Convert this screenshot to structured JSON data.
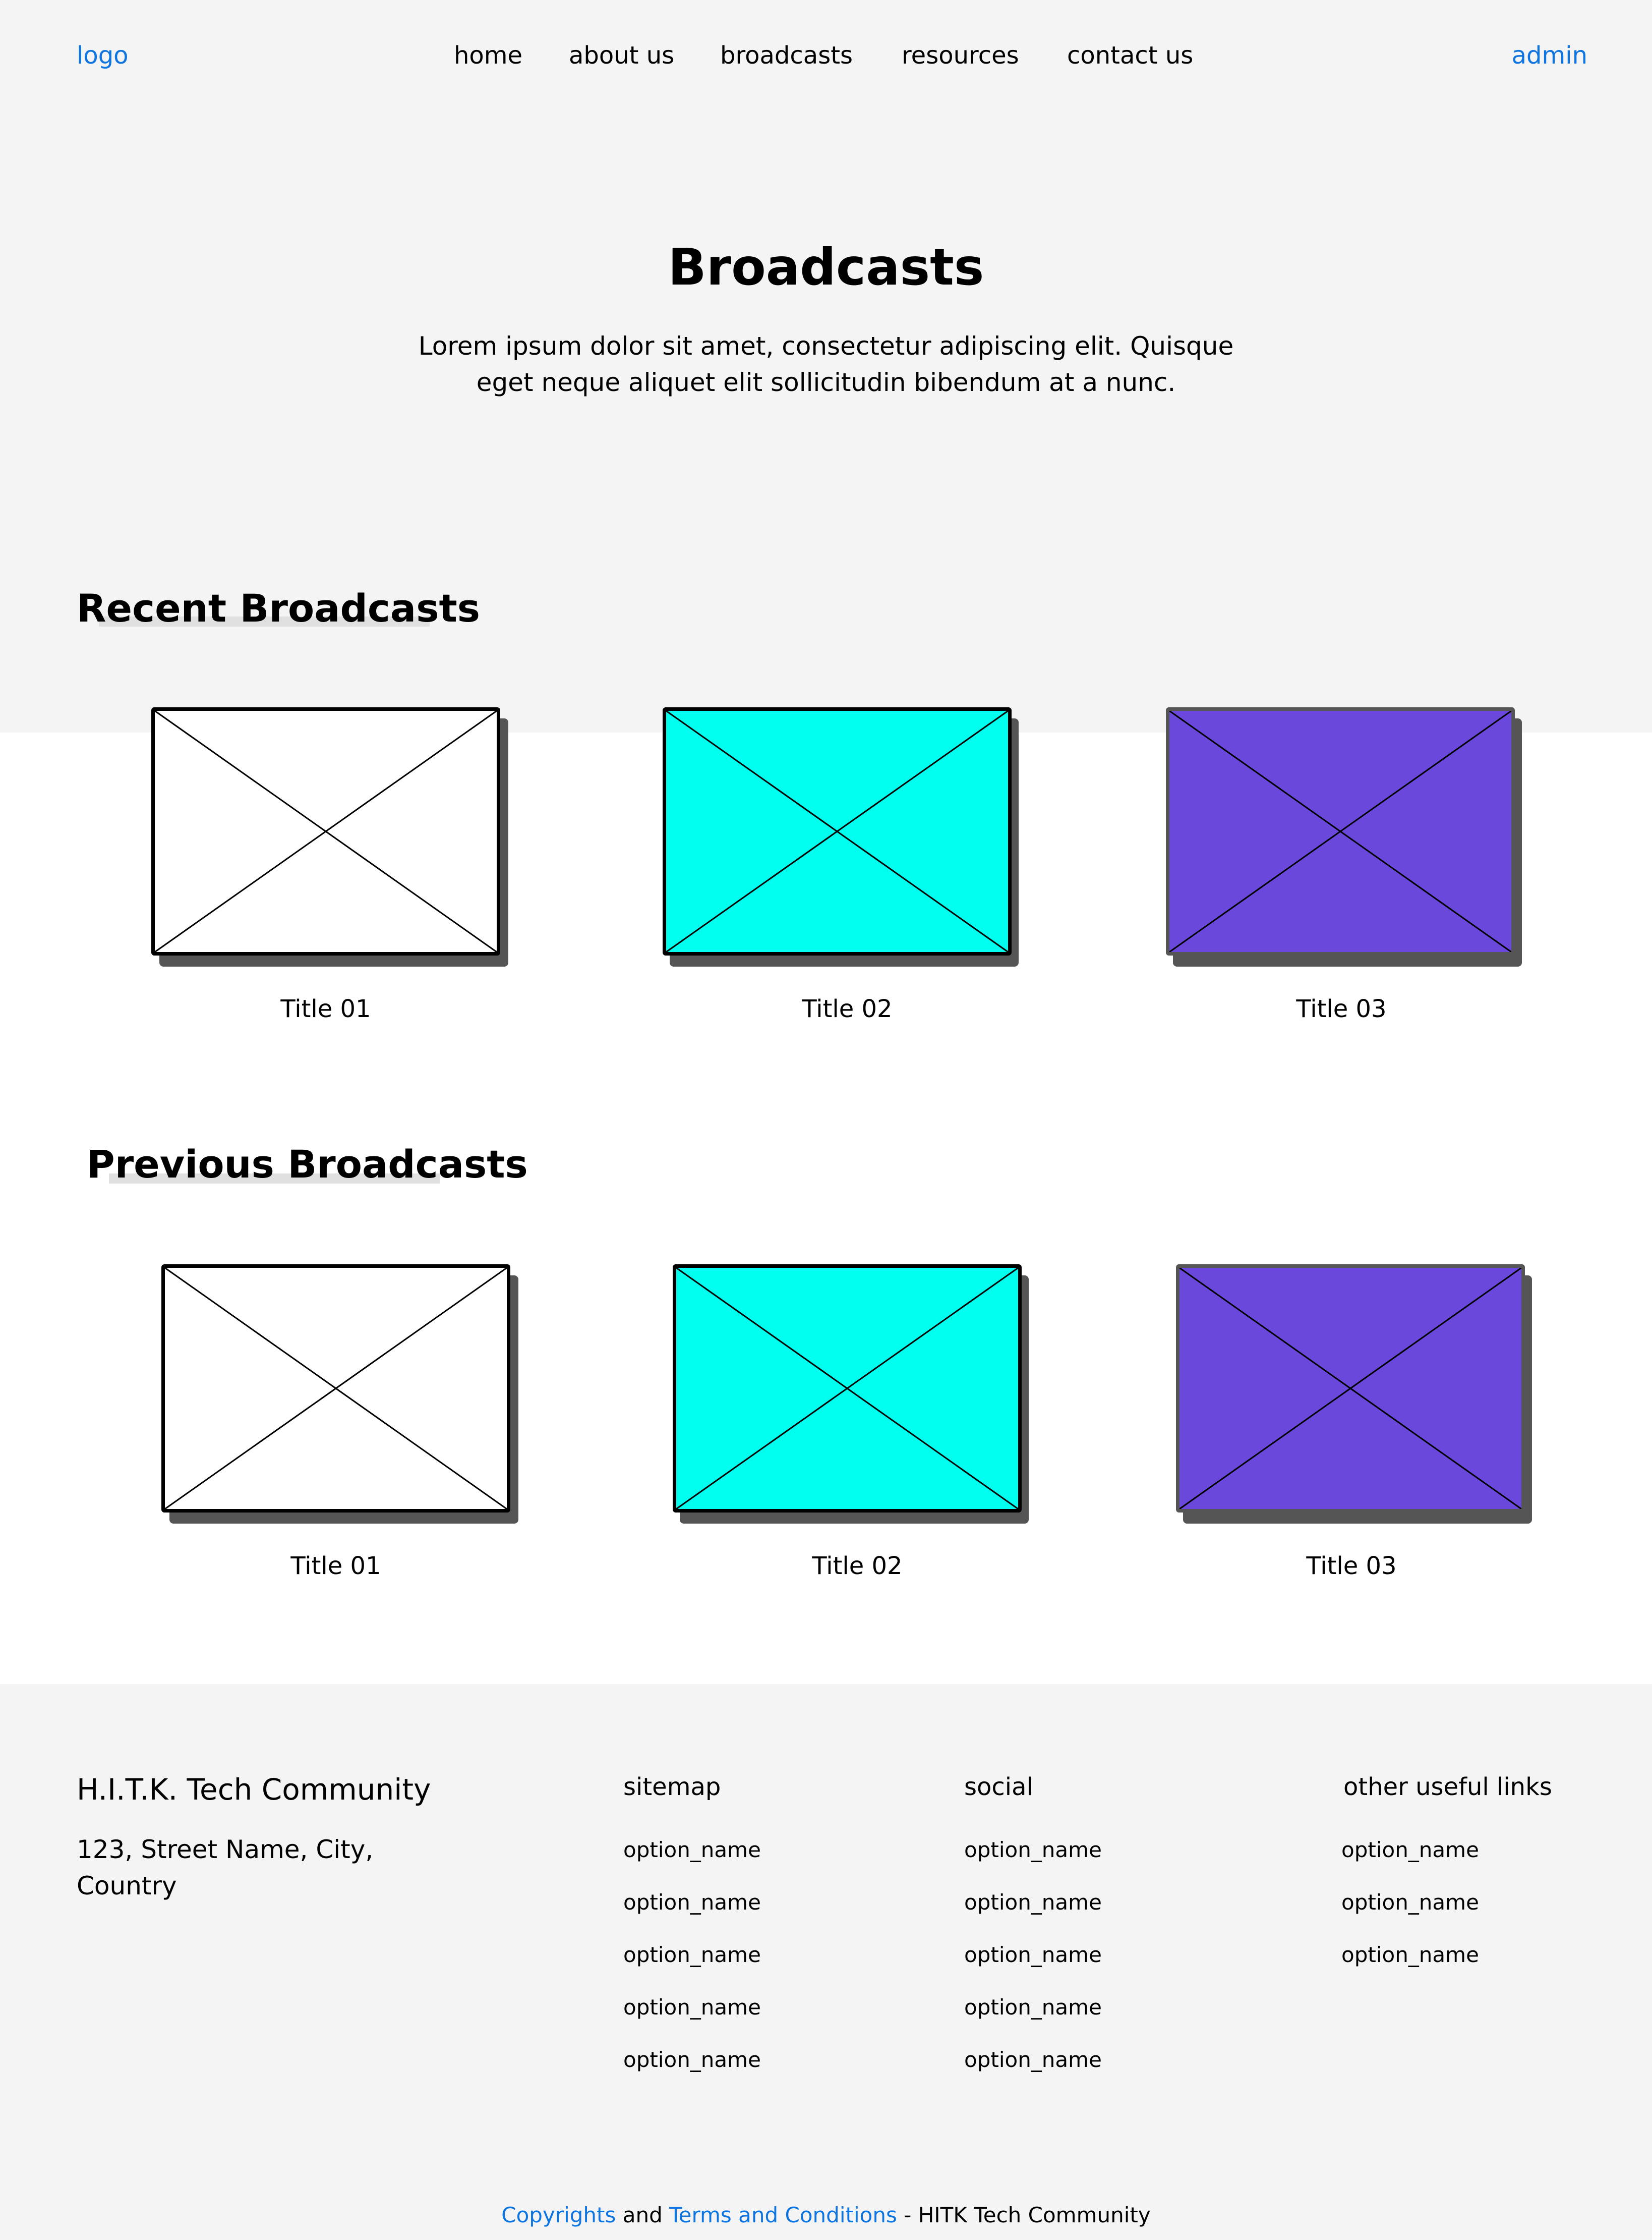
{
  "nav": {
    "logo": "logo",
    "links": [
      "home",
      "about us",
      "broadcasts",
      "resources",
      "contact us"
    ],
    "admin": "admin"
  },
  "hero": {
    "title": "Broadcasts",
    "description": "Lorem ipsum dolor sit amet, consectetur adipiscing elit. Quisque eget neque aliquet elit sollicitudin bibendum at a nunc."
  },
  "recent": {
    "heading": "Recent Broadcasts",
    "cards": [
      {
        "title": "Title 01",
        "fill": "#ffffff",
        "border": "#000000"
      },
      {
        "title": "Title 02",
        "fill": "#00ffee",
        "border": "#000000"
      },
      {
        "title": "Title 03",
        "fill": "#6b48dc",
        "border": "#555555"
      }
    ]
  },
  "previous": {
    "heading": "Previous Broadcasts",
    "cards": [
      {
        "title": "Title 01",
        "fill": "#ffffff",
        "border": "#000000"
      },
      {
        "title": "Title 02",
        "fill": "#00ffee",
        "border": "#000000"
      },
      {
        "title": "Title 03",
        "fill": "#6b48dc",
        "border": "#555555"
      }
    ]
  },
  "footer": {
    "brand": "H.I.T.K. Tech Community",
    "address": "123, Street Name, City, Country",
    "sitemap": {
      "heading": "sitemap",
      "items": [
        "option_name",
        "option_name",
        "option_name",
        "option_name",
        "option_name"
      ]
    },
    "social": {
      "heading": "social",
      "items": [
        "option_name",
        "option_name",
        "option_name",
        "option_name",
        "option_name"
      ]
    },
    "other": {
      "heading": "other useful links",
      "items": [
        "option_name",
        "option_name",
        "option_name"
      ]
    },
    "copyrights": "Copyrights",
    "and": "and",
    "terms": "Terms and Conditions",
    "suffix": "- HITK Tech Community"
  },
  "colors": {
    "accent": "#0d74e0",
    "band": "#f4f4f4",
    "cyan": "#00ffee",
    "purple": "#6b48dc",
    "shadow": "#555555"
  }
}
